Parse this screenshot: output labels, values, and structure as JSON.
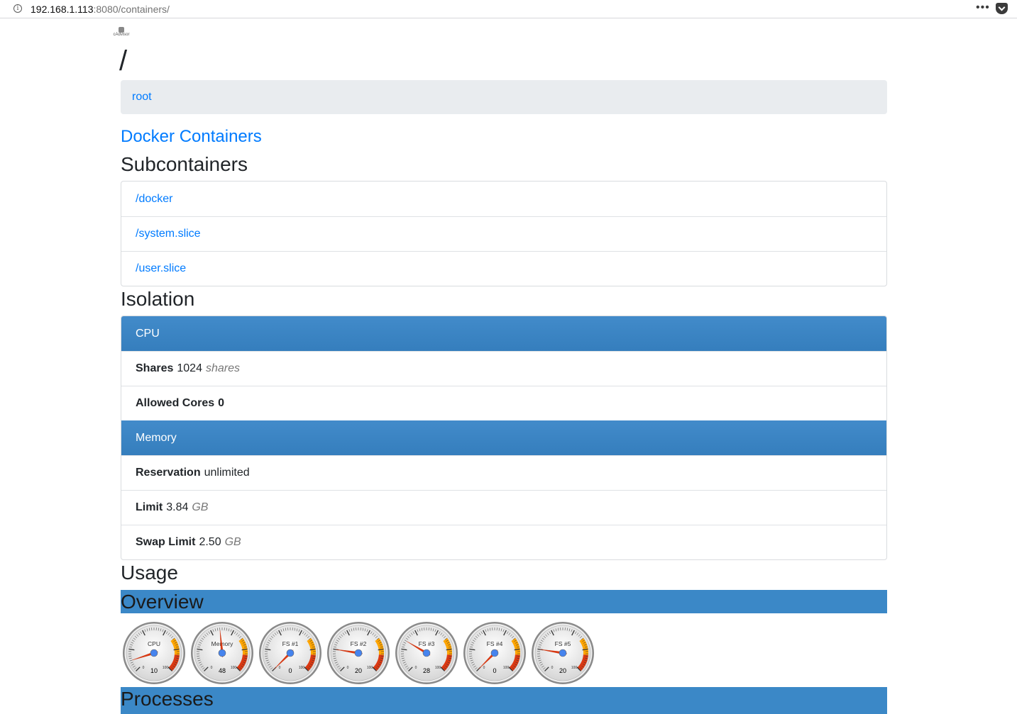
{
  "browser": {
    "info_glyph": "i",
    "url_host": "192.168.1.113",
    "url_rest": ":8080/containers/",
    "more_glyph": "•••"
  },
  "logo": {
    "text": "cAdvisor"
  },
  "page": {
    "title": "/"
  },
  "breadcrumb": {
    "label": "root"
  },
  "docker_link": "Docker Containers",
  "subcontainers": {
    "title": "Subcontainers",
    "items": [
      "/docker",
      "/system.slice",
      "/user.slice"
    ]
  },
  "isolation": {
    "title": "Isolation",
    "cpu": {
      "header": "CPU",
      "shares": {
        "key": "Shares",
        "value": "1024",
        "unit": "shares"
      },
      "allowed_cores": {
        "key": "Allowed Cores",
        "value": "0"
      }
    },
    "memory": {
      "header": "Memory",
      "reservation": {
        "key": "Reservation",
        "value": "unlimited"
      },
      "limit": {
        "key": "Limit",
        "value": "3.84",
        "unit": "GB"
      },
      "swap_limit": {
        "key": "Swap Limit",
        "value": "2.50",
        "unit": "GB"
      }
    }
  },
  "usage": {
    "title": "Usage",
    "overview_title": "Overview",
    "processes_title": "Processes",
    "scale_min": "0",
    "scale_max": "100",
    "gauges": [
      {
        "label": "CPU",
        "value": 10
      },
      {
        "label": "Memory",
        "value": 48
      },
      {
        "label": "FS #1",
        "value": 0
      },
      {
        "label": "FS #2",
        "value": 20
      },
      {
        "label": "FS #3",
        "value": 28
      },
      {
        "label": "FS #4",
        "value": 0
      },
      {
        "label": "FS #5",
        "value": 20
      }
    ]
  }
}
